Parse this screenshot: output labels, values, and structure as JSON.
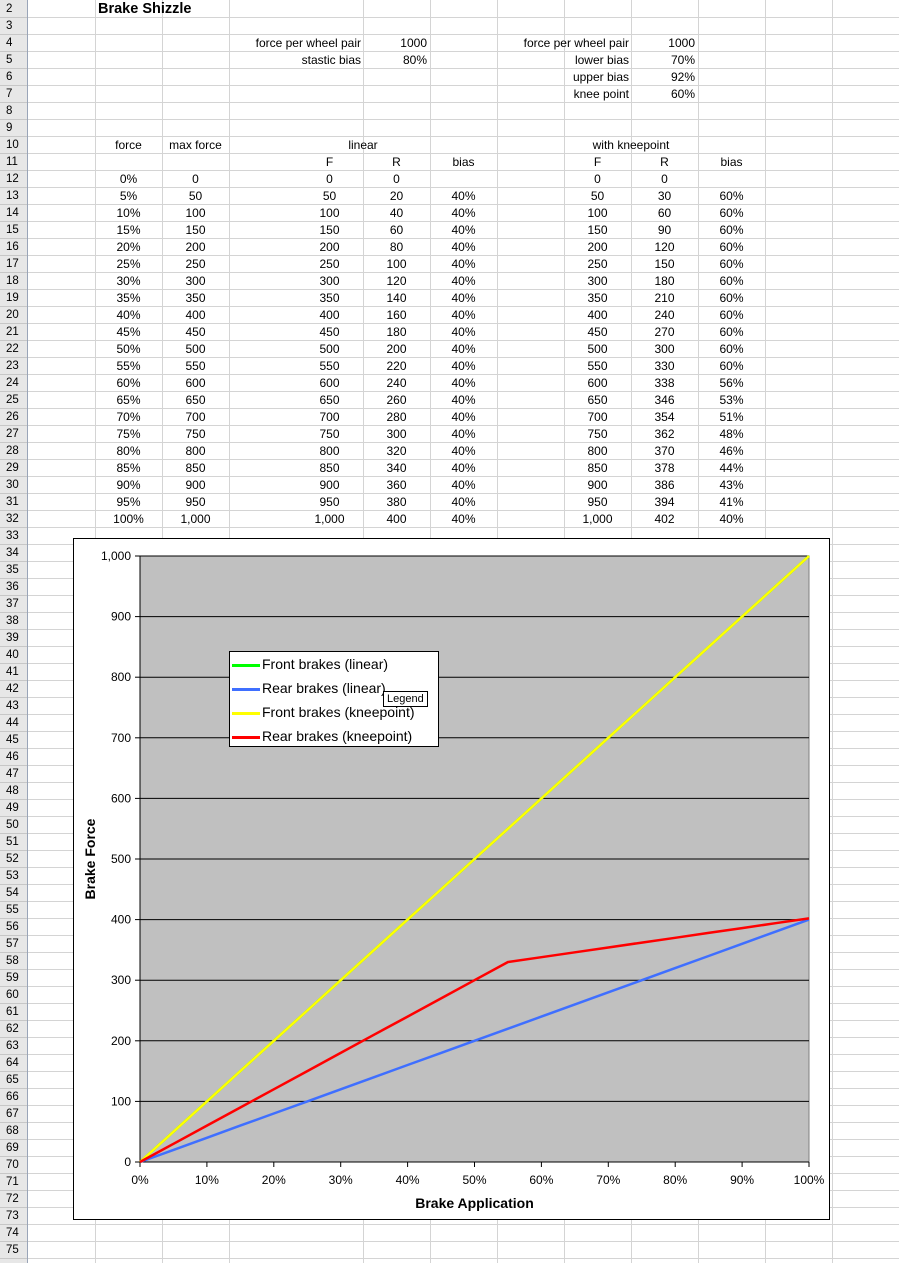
{
  "sheet": {
    "first_row": 2,
    "last_row": 75,
    "title": "Brake Shizzle",
    "params_left": [
      {
        "label": "force per wheel pair",
        "value": "1000"
      },
      {
        "label": "stastic bias",
        "value": "80%"
      }
    ],
    "params_right": [
      {
        "label": "force per wheel pair",
        "value": "1000"
      },
      {
        "label": "lower bias",
        "value": "70%"
      },
      {
        "label": "upper bias",
        "value": "92%"
      },
      {
        "label": "knee point",
        "value": "60%"
      }
    ],
    "headers": {
      "force": "force",
      "max_force": "max force",
      "linear": "linear",
      "kneepoint": "with kneepoint",
      "F": "F",
      "R": "R",
      "bias": "bias"
    },
    "rows": [
      [
        "0%",
        "0",
        "0",
        "0",
        "",
        "0",
        "0",
        ""
      ],
      [
        "5%",
        "50",
        "50",
        "20",
        "40%",
        "50",
        "30",
        "60%"
      ],
      [
        "10%",
        "100",
        "100",
        "40",
        "40%",
        "100",
        "60",
        "60%"
      ],
      [
        "15%",
        "150",
        "150",
        "60",
        "40%",
        "150",
        "90",
        "60%"
      ],
      [
        "20%",
        "200",
        "200",
        "80",
        "40%",
        "200",
        "120",
        "60%"
      ],
      [
        "25%",
        "250",
        "250",
        "100",
        "40%",
        "250",
        "150",
        "60%"
      ],
      [
        "30%",
        "300",
        "300",
        "120",
        "40%",
        "300",
        "180",
        "60%"
      ],
      [
        "35%",
        "350",
        "350",
        "140",
        "40%",
        "350",
        "210",
        "60%"
      ],
      [
        "40%",
        "400",
        "400",
        "160",
        "40%",
        "400",
        "240",
        "60%"
      ],
      [
        "45%",
        "450",
        "450",
        "180",
        "40%",
        "450",
        "270",
        "60%"
      ],
      [
        "50%",
        "500",
        "500",
        "200",
        "40%",
        "500",
        "300",
        "60%"
      ],
      [
        "55%",
        "550",
        "550",
        "220",
        "40%",
        "550",
        "330",
        "60%"
      ],
      [
        "60%",
        "600",
        "600",
        "240",
        "40%",
        "600",
        "338",
        "56%"
      ],
      [
        "65%",
        "650",
        "650",
        "260",
        "40%",
        "650",
        "346",
        "53%"
      ],
      [
        "70%",
        "700",
        "700",
        "280",
        "40%",
        "700",
        "354",
        "51%"
      ],
      [
        "75%",
        "750",
        "750",
        "300",
        "40%",
        "750",
        "362",
        "48%"
      ],
      [
        "80%",
        "800",
        "800",
        "320",
        "40%",
        "800",
        "370",
        "46%"
      ],
      [
        "85%",
        "850",
        "850",
        "340",
        "40%",
        "850",
        "378",
        "44%"
      ],
      [
        "90%",
        "900",
        "900",
        "360",
        "40%",
        "900",
        "386",
        "43%"
      ],
      [
        "95%",
        "950",
        "950",
        "380",
        "40%",
        "950",
        "394",
        "41%"
      ],
      [
        "100%",
        "1,000",
        "1,000",
        "400",
        "40%",
        "1,000",
        "402",
        "40%"
      ]
    ]
  },
  "tooltip": "Legend",
  "chart_data": {
    "type": "line",
    "xlabel": "Brake Application",
    "ylabel": "Brake Force",
    "x": [
      0,
      5,
      10,
      15,
      20,
      25,
      30,
      35,
      40,
      45,
      50,
      55,
      60,
      65,
      70,
      75,
      80,
      85,
      90,
      95,
      100
    ],
    "xticks": [
      "0%",
      "10%",
      "20%",
      "30%",
      "40%",
      "50%",
      "60%",
      "70%",
      "80%",
      "90%",
      "100%"
    ],
    "yticks": [
      "0",
      "100",
      "200",
      "300",
      "400",
      "500",
      "600",
      "700",
      "800",
      "900",
      "1,000"
    ],
    "xlim": [
      0,
      100
    ],
    "ylim": [
      0,
      1000
    ],
    "grid": "horizontal",
    "legend_position": "upper-left",
    "plot_background": "#c0c0c0",
    "series": [
      {
        "name": "Front brakes (linear)",
        "color": "#00ff00",
        "values": [
          0,
          50,
          100,
          150,
          200,
          250,
          300,
          350,
          400,
          450,
          500,
          550,
          600,
          650,
          700,
          750,
          800,
          850,
          900,
          950,
          1000
        ]
      },
      {
        "name": "Rear brakes (linear)",
        "color": "#3f6fff",
        "values": [
          0,
          20,
          40,
          60,
          80,
          100,
          120,
          140,
          160,
          180,
          200,
          220,
          240,
          260,
          280,
          300,
          320,
          340,
          360,
          380,
          400
        ]
      },
      {
        "name": "Front brakes (kneepoint)",
        "color": "#ffff00",
        "values": [
          0,
          50,
          100,
          150,
          200,
          250,
          300,
          350,
          400,
          450,
          500,
          550,
          600,
          650,
          700,
          750,
          800,
          850,
          900,
          950,
          1000
        ]
      },
      {
        "name": "Rear brakes (kneepoint)",
        "color": "#ff0000",
        "values": [
          0,
          30,
          60,
          90,
          120,
          150,
          180,
          210,
          240,
          270,
          300,
          330,
          338,
          346,
          354,
          362,
          370,
          378,
          386,
          394,
          402
        ]
      }
    ]
  }
}
